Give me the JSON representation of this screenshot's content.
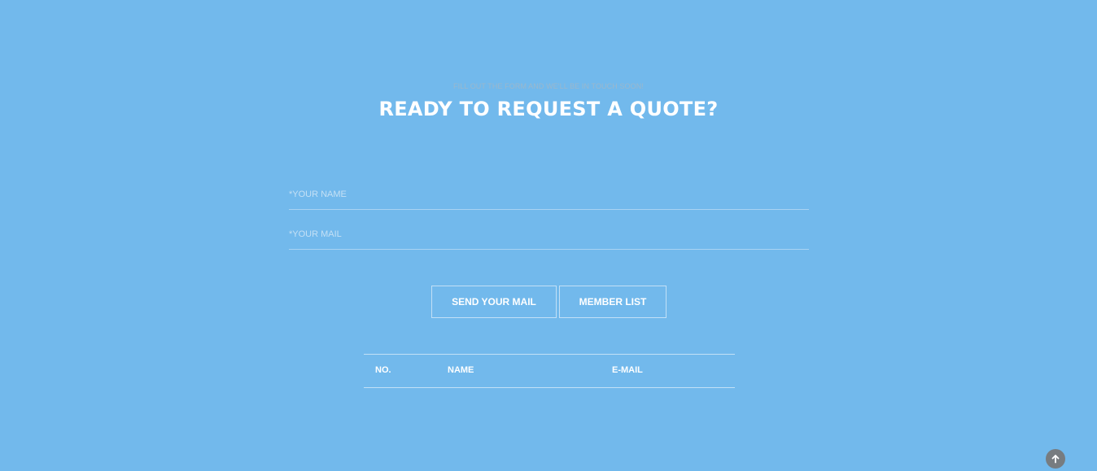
{
  "header": {
    "eyebrow": "FILL OUT THE FORM AND WE'LL BE IN TOUCH SOON!",
    "title": "READY TO REQUEST A QUOTE?"
  },
  "form": {
    "name_placeholder": "*YOUR NAME",
    "name_value": "",
    "mail_placeholder": "*YOUR MAIL",
    "mail_value": ""
  },
  "buttons": {
    "send_label": "SEND YOUR MAIL",
    "member_list_label": "MEMBER LIST"
  },
  "table": {
    "columns": [
      "NO.",
      "NAME",
      "E-MAIL"
    ],
    "rows": []
  },
  "icons": {
    "scroll_top": "arrow-up-icon"
  },
  "colors": {
    "background": "#72b9ec",
    "text": "#ffffff",
    "scroll_button": "#777c80"
  }
}
